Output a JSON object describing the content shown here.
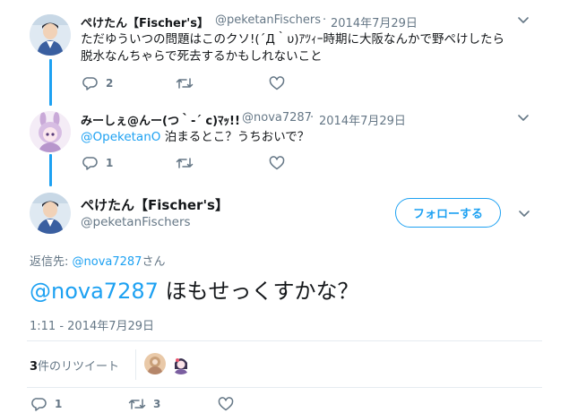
{
  "tweet1": {
    "name": "ぺけたん【Fischer's】",
    "handle": "@peketanFischers",
    "separator": "·",
    "date": "2014年7月29日",
    "text_line1": "ただゆういつの問題はこのクソ!(´Д｀υ)ｱﾂｨｰ時期に大阪なんかで野ぺけしたら",
    "text_line2": "脱水なんちゃらで死去するかもしれないこと",
    "reply_count": "2",
    "retweet_count": "",
    "like_count": ""
  },
  "tweet2": {
    "name": "みーしぇ@んー(つ｀-´ c)ﾏｯ!!",
    "handle": "@nova7287",
    "separator": "·",
    "date": "2014年7月29日",
    "mention": "@OpeketanO",
    "text": " 泊まるとこ？うちおいで？",
    "reply_count": "1",
    "retweet_count": "",
    "like_count": ""
  },
  "main": {
    "name": "ぺけたん【Fischer's】",
    "handle": "@peketanFischers",
    "follow_label": "フォローする",
    "reply_to_label": "返信先: ",
    "reply_to_handle": "@nova7287",
    "reply_to_suffix": "さん",
    "mention": "@nova7287",
    "text": " ほもせっくすかな？",
    "timestamp": "1:11 - 2014年7月29日",
    "retweets_number": "3",
    "retweets_label": "件のリツイート",
    "reply_count": "1",
    "retweet_count": "3",
    "like_count": ""
  },
  "colors": {
    "accent": "#1da1f2",
    "secondary_text": "#657786",
    "primary_text": "#14171a",
    "divider": "#e6ecf0"
  },
  "icons": {
    "reply": "reply-icon",
    "retweet": "retweet-icon",
    "like": "heart-icon",
    "more": "chevron-down-icon"
  }
}
